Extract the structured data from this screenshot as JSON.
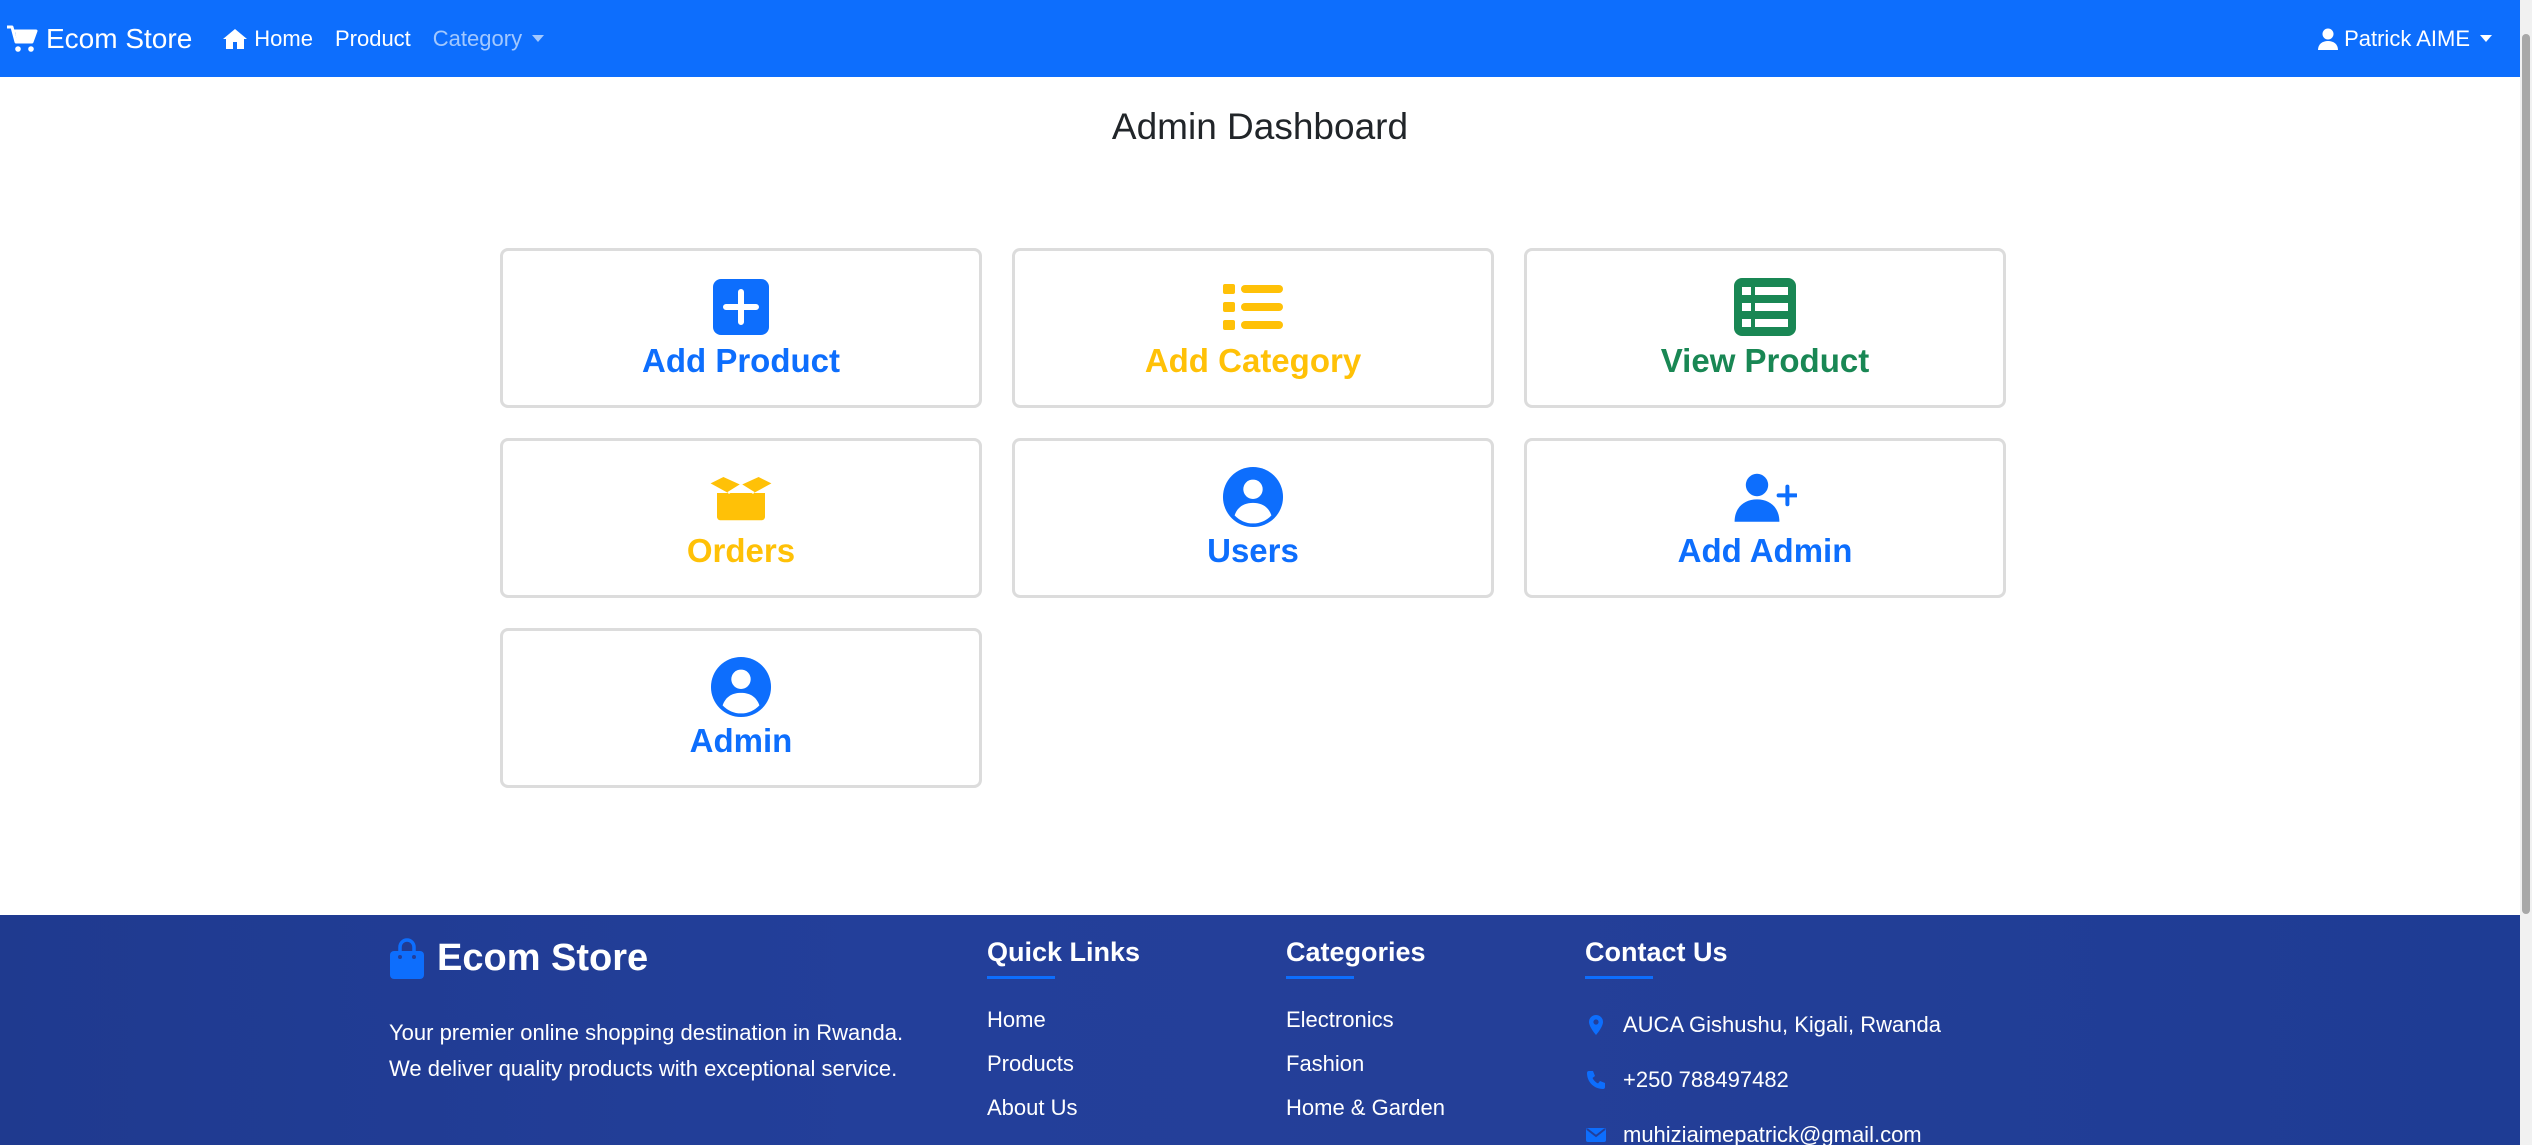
{
  "navbar": {
    "brand": "Ecom Store",
    "home": "Home",
    "product": "Product",
    "category": "Category",
    "user": "Patrick AIME"
  },
  "page": {
    "title": "Admin Dashboard"
  },
  "cards": {
    "add_product": "Add Product",
    "add_category": "Add Category",
    "view_product": "View Product",
    "orders": "Orders",
    "users": "Users",
    "add_admin": "Add Admin",
    "admin": "Admin"
  },
  "colors": {
    "primary": "#0d6efd",
    "warning": "#ffc107",
    "success": "#198754",
    "footer": "#233f9a"
  },
  "footer": {
    "brand": "Ecom Store",
    "description": "Your premier online shopping destination in Rwanda. We deliver quality products with exceptional service.",
    "quick_links": {
      "title": "Quick Links",
      "items": [
        "Home",
        "Products",
        "About Us"
      ]
    },
    "categories": {
      "title": "Categories",
      "items": [
        "Electronics",
        "Fashion",
        "Home & Garden"
      ]
    },
    "contact": {
      "title": "Contact Us",
      "address": "AUCA Gishushu, Kigali, Rwanda",
      "phone": "+250 788497482",
      "email": "muhiziaimepatrick@gmail.com"
    }
  }
}
